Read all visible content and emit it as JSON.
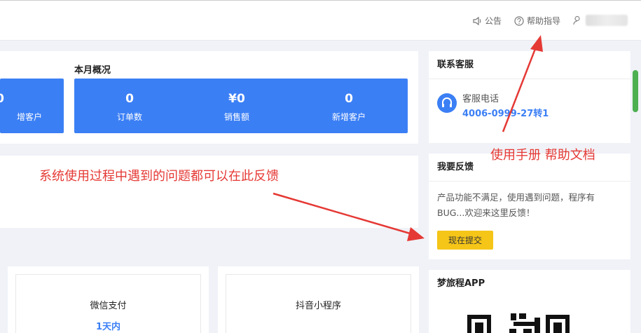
{
  "header": {
    "announce_label": "公告",
    "help_label": "帮助指导"
  },
  "stats": {
    "left_partial": {
      "value": "0",
      "label": "增客户"
    },
    "month_title": "本月概况",
    "month": [
      {
        "value": "0",
        "label": "订单数"
      },
      {
        "value": "¥0",
        "label": "销售额"
      },
      {
        "value": "0",
        "label": "新增客户"
      }
    ]
  },
  "payments": [
    {
      "title": "微信支付",
      "sub": "1天内"
    },
    {
      "title": "抖音小程序",
      "sub": ""
    }
  ],
  "sidebar": {
    "service": {
      "title": "联系客服",
      "label": "客服电话",
      "phone": "4006-0999-27转1"
    },
    "feedback": {
      "title": "我要反馈",
      "text": "产品功能不满足，使用遇到问题，程序有BUG...欢迎来这里反馈！",
      "button": "现在提交"
    },
    "app": {
      "title": "梦旅程APP"
    }
  },
  "annotations": {
    "manual": "使用手册 帮助文档",
    "feedback_hint": "系统使用过程中遇到的问题都可以在此反馈"
  },
  "colors": {
    "accent": "#3b7ff5",
    "button": "#f5c518",
    "annotation": "#e53935"
  }
}
